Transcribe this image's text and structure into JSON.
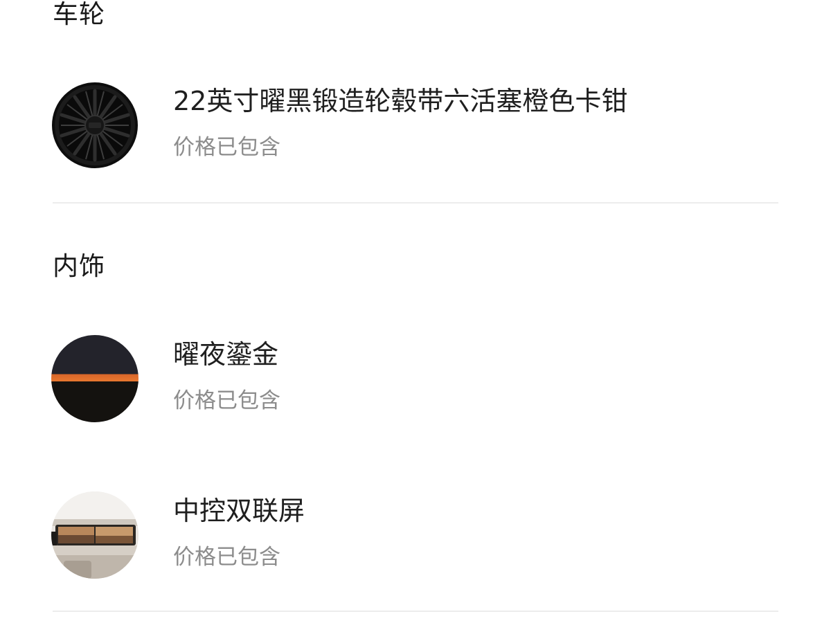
{
  "sections": [
    {
      "title": "车轮",
      "items": [
        {
          "name": "22英寸曜黑锻造轮毂带六活塞橙色卡钳",
          "price_note": "价格已包含",
          "thumb_icon": "wheel-rim-icon"
        }
      ]
    },
    {
      "title": "内饰",
      "items": [
        {
          "name": "曜夜鎏金",
          "price_note": "价格已包含",
          "thumb_icon": "interior-color-swatch-icon",
          "colors": [
            "#23232b",
            "#e8772f",
            "#14120f"
          ]
        },
        {
          "name": "中控双联屏",
          "price_note": "价格已包含",
          "thumb_icon": "dual-screen-dashboard-icon"
        }
      ]
    }
  ]
}
